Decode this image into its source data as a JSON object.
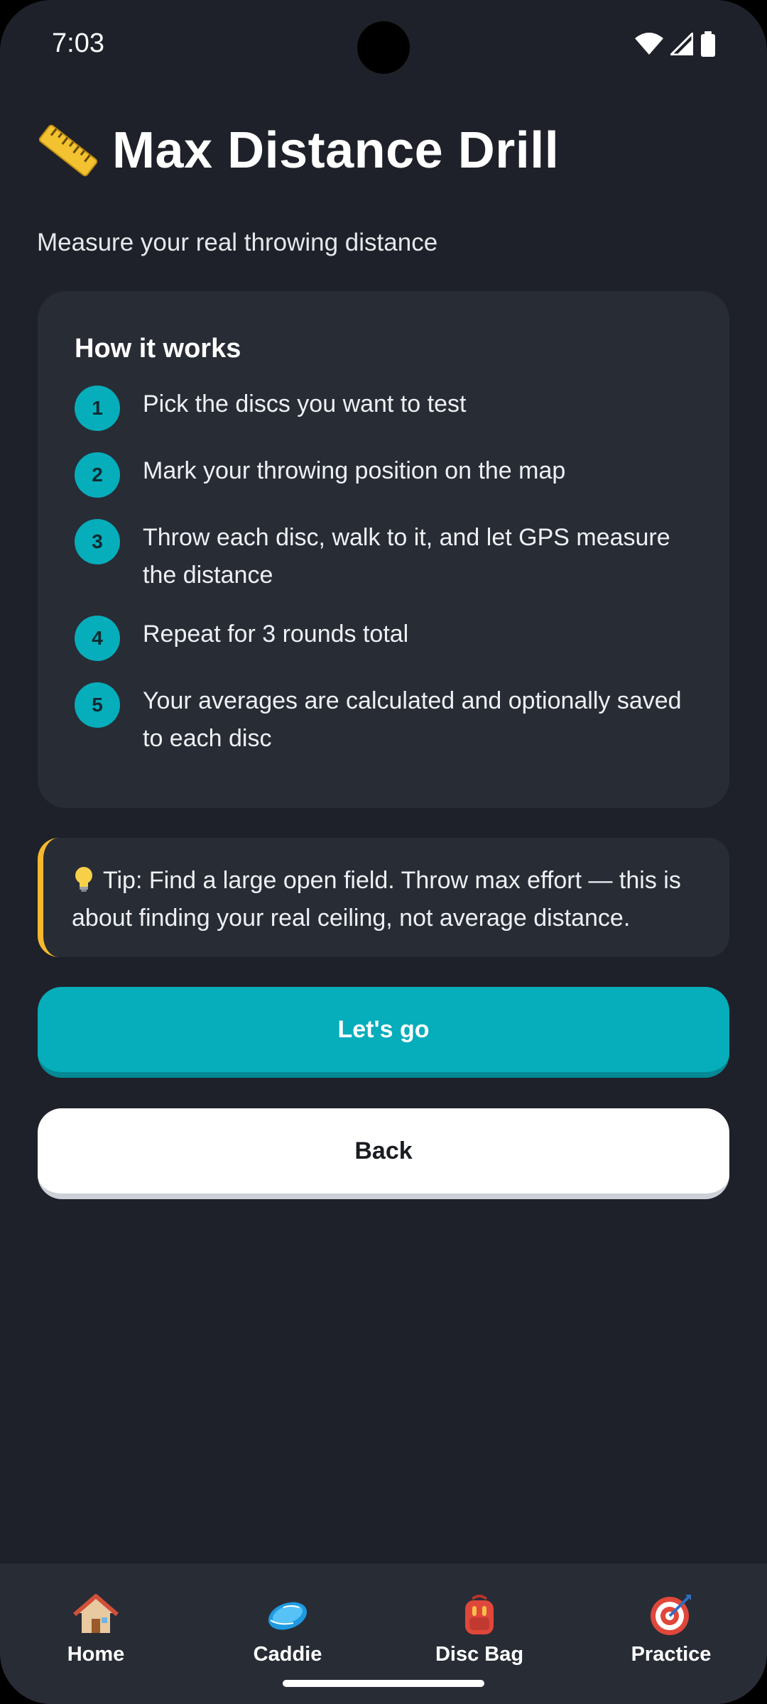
{
  "status_bar": {
    "time": "7:03",
    "icons": [
      "wifi-icon",
      "signal-icon",
      "battery-icon"
    ]
  },
  "header": {
    "icon": "ruler-icon",
    "title": "Max Distance Drill",
    "subtitle": "Measure your real throwing distance"
  },
  "how_it_works": {
    "title": "How it works",
    "steps": [
      {
        "number": "1",
        "text": "Pick the discs you want to test"
      },
      {
        "number": "2",
        "text": "Mark your throwing position on the map"
      },
      {
        "number": "3",
        "text": "Throw each disc, walk to it, and let GPS measure the distance"
      },
      {
        "number": "4",
        "text": "Repeat for 3 rounds total"
      },
      {
        "number": "5",
        "text": "Your averages are calculated and optionally saved to each disc"
      }
    ]
  },
  "tip": {
    "icon": "lightbulb-icon",
    "text": "Tip: Find a large open field. Throw max effort — this is about finding your real ceiling, not average distance."
  },
  "buttons": {
    "primary_label": "Let's go",
    "secondary_label": "Back"
  },
  "bottom_nav": {
    "items": [
      {
        "icon": "home-icon",
        "label": "Home"
      },
      {
        "icon": "disc-icon",
        "label": "Caddie"
      },
      {
        "icon": "backpack-icon",
        "label": "Disc Bag"
      },
      {
        "icon": "target-icon",
        "label": "Practice"
      }
    ]
  },
  "colors": {
    "background": "#1e2129",
    "card": "#282c35",
    "accent": "#06adbb",
    "tip_border": "#f5b82e",
    "text": "#ffffff"
  }
}
